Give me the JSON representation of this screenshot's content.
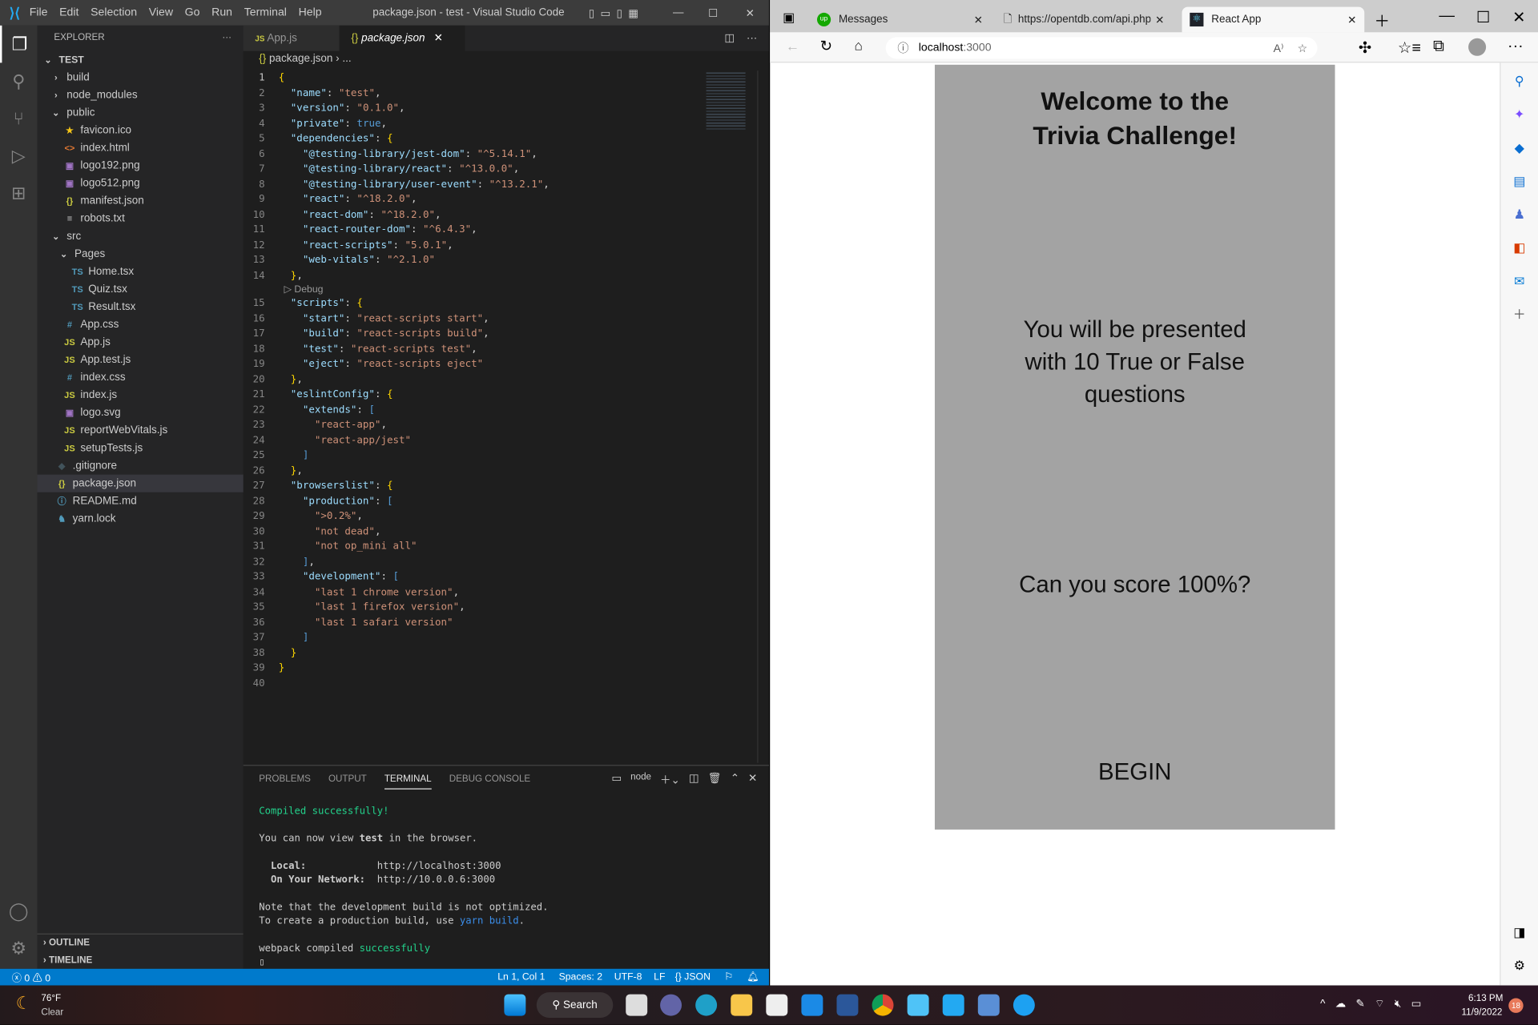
{
  "vscode": {
    "title": "package.json - test - Visual Studio Code",
    "menu": [
      "File",
      "Edit",
      "Selection",
      "View",
      "Go",
      "Run",
      "Terminal",
      "Help"
    ],
    "explorer_label": "EXPLORER",
    "root": "TEST",
    "tree": [
      {
        "name": "build",
        "icon": "chevron-right",
        "depth": 1
      },
      {
        "name": "node_modules",
        "icon": "chevron-right",
        "depth": 1
      },
      {
        "name": "public",
        "icon": "chevron-down",
        "depth": 1
      },
      {
        "name": "favicon.ico",
        "icon": "star",
        "depth": 2
      },
      {
        "name": "index.html",
        "icon": "html",
        "depth": 2
      },
      {
        "name": "logo192.png",
        "icon": "image",
        "depth": 2
      },
      {
        "name": "logo512.png",
        "icon": "image",
        "depth": 2
      },
      {
        "name": "manifest.json",
        "icon": "json",
        "depth": 2
      },
      {
        "name": "robots.txt",
        "icon": "text",
        "depth": 2
      },
      {
        "name": "src",
        "icon": "chevron-down",
        "depth": 1
      },
      {
        "name": "Pages",
        "icon": "chevron-down",
        "depth": 2
      },
      {
        "name": "Home.tsx",
        "icon": "ts",
        "depth": 3
      },
      {
        "name": "Quiz.tsx",
        "icon": "ts",
        "depth": 3
      },
      {
        "name": "Result.tsx",
        "icon": "ts",
        "depth": 3
      },
      {
        "name": "App.css",
        "icon": "css",
        "depth": 2
      },
      {
        "name": "App.js",
        "icon": "js",
        "depth": 2
      },
      {
        "name": "App.test.js",
        "icon": "js",
        "depth": 2
      },
      {
        "name": "index.css",
        "icon": "css",
        "depth": 2
      },
      {
        "name": "index.js",
        "icon": "js",
        "depth": 2
      },
      {
        "name": "logo.svg",
        "icon": "image",
        "depth": 2
      },
      {
        "name": "reportWebVitals.js",
        "icon": "js",
        "depth": 2
      },
      {
        "name": "setupTests.js",
        "icon": "js",
        "depth": 2
      },
      {
        "name": ".gitignore",
        "icon": "git",
        "depth": 1
      },
      {
        "name": "package.json",
        "icon": "json",
        "depth": 1,
        "selected": true
      },
      {
        "name": "README.md",
        "icon": "info",
        "depth": 1
      },
      {
        "name": "yarn.lock",
        "icon": "yarn",
        "depth": 1
      }
    ],
    "outline": "OUTLINE",
    "timeline": "TIMELINE",
    "tabs": [
      {
        "label": "App.js",
        "icon": "JS"
      },
      {
        "label": "package.json",
        "icon": "{}",
        "active": true
      }
    ],
    "breadcrumb": [
      "package.json",
      "..."
    ],
    "codelens": "Debug",
    "code": [
      "{",
      "  \"name\": \"test\",",
      "  \"version\": \"0.1.0\",",
      "  \"private\": true,",
      "  \"dependencies\": {",
      "    \"@testing-library/jest-dom\": \"^5.14.1\",",
      "    \"@testing-library/react\": \"^13.0.0\",",
      "    \"@testing-library/user-event\": \"^13.2.1\",",
      "    \"react\": \"^18.2.0\",",
      "    \"react-dom\": \"^18.2.0\",",
      "    \"react-router-dom\": \"^6.4.3\",",
      "    \"react-scripts\": \"5.0.1\",",
      "    \"web-vitals\": \"^2.1.0\"",
      "  },",
      "  \"scripts\": {",
      "    \"start\": \"react-scripts start\",",
      "    \"build\": \"react-scripts build\",",
      "    \"test\": \"react-scripts test\",",
      "    \"eject\": \"react-scripts eject\"",
      "  },",
      "  \"eslintConfig\": {",
      "    \"extends\": [",
      "      \"react-app\",",
      "      \"react-app/jest\"",
      "    ]",
      "  },",
      "  \"browserslist\": {",
      "    \"production\": [",
      "      \">0.2%\",",
      "      \"not dead\",",
      "      \"not op_mini all\"",
      "    ],",
      "    \"development\": [",
      "      \"last 1 chrome version\",",
      "      \"last 1 firefox version\",",
      "      \"last 1 safari version\"",
      "    ]",
      "  }",
      "}",
      ""
    ],
    "panel_tabs": [
      "PROBLEMS",
      "OUTPUT",
      "TERMINAL",
      "DEBUG CONSOLE"
    ],
    "terminal_name": "node",
    "terminal": {
      "compiled": "Compiled successfully!",
      "view_pre": "You can now view ",
      "view_app": "test",
      "view_post": " in the browser.",
      "local_label": "  Local:            ",
      "local_url": "http://localhost:3000",
      "net_label": "  On Your Network:  ",
      "net_url": "http://10.0.0.6:3000",
      "note1": "Note that the development build is not optimized.",
      "note2_pre": "To create a production build, use ",
      "note2_cmd": "yarn build",
      "note2_post": ".",
      "webpack_pre": "webpack compiled ",
      "webpack_ok": "successfully"
    },
    "status": {
      "errors": "0",
      "warnings": "0",
      "position": "Ln 1, Col 1",
      "spaces": "Spaces: 2",
      "encoding": "UTF-8",
      "eol": "LF",
      "language": "{} JSON"
    }
  },
  "browser": {
    "tabs": [
      {
        "label": "Messages"
      },
      {
        "label": "https://opentdb.com/api.php?a"
      },
      {
        "label": "React App",
        "active": true
      }
    ],
    "url_host": "localhost",
    "url_port": ":3000",
    "page": {
      "title": "Welcome to the Trivia Challenge!",
      "intro": "You will be presented with 10 True or False questions",
      "question": "Can you score 100%?",
      "begin": "BEGIN"
    }
  },
  "taskbar": {
    "temp": "76°F",
    "weather": "Clear",
    "search": "Search",
    "time": "6:13 PM",
    "date": "11/9/2022",
    "badge": "18"
  }
}
